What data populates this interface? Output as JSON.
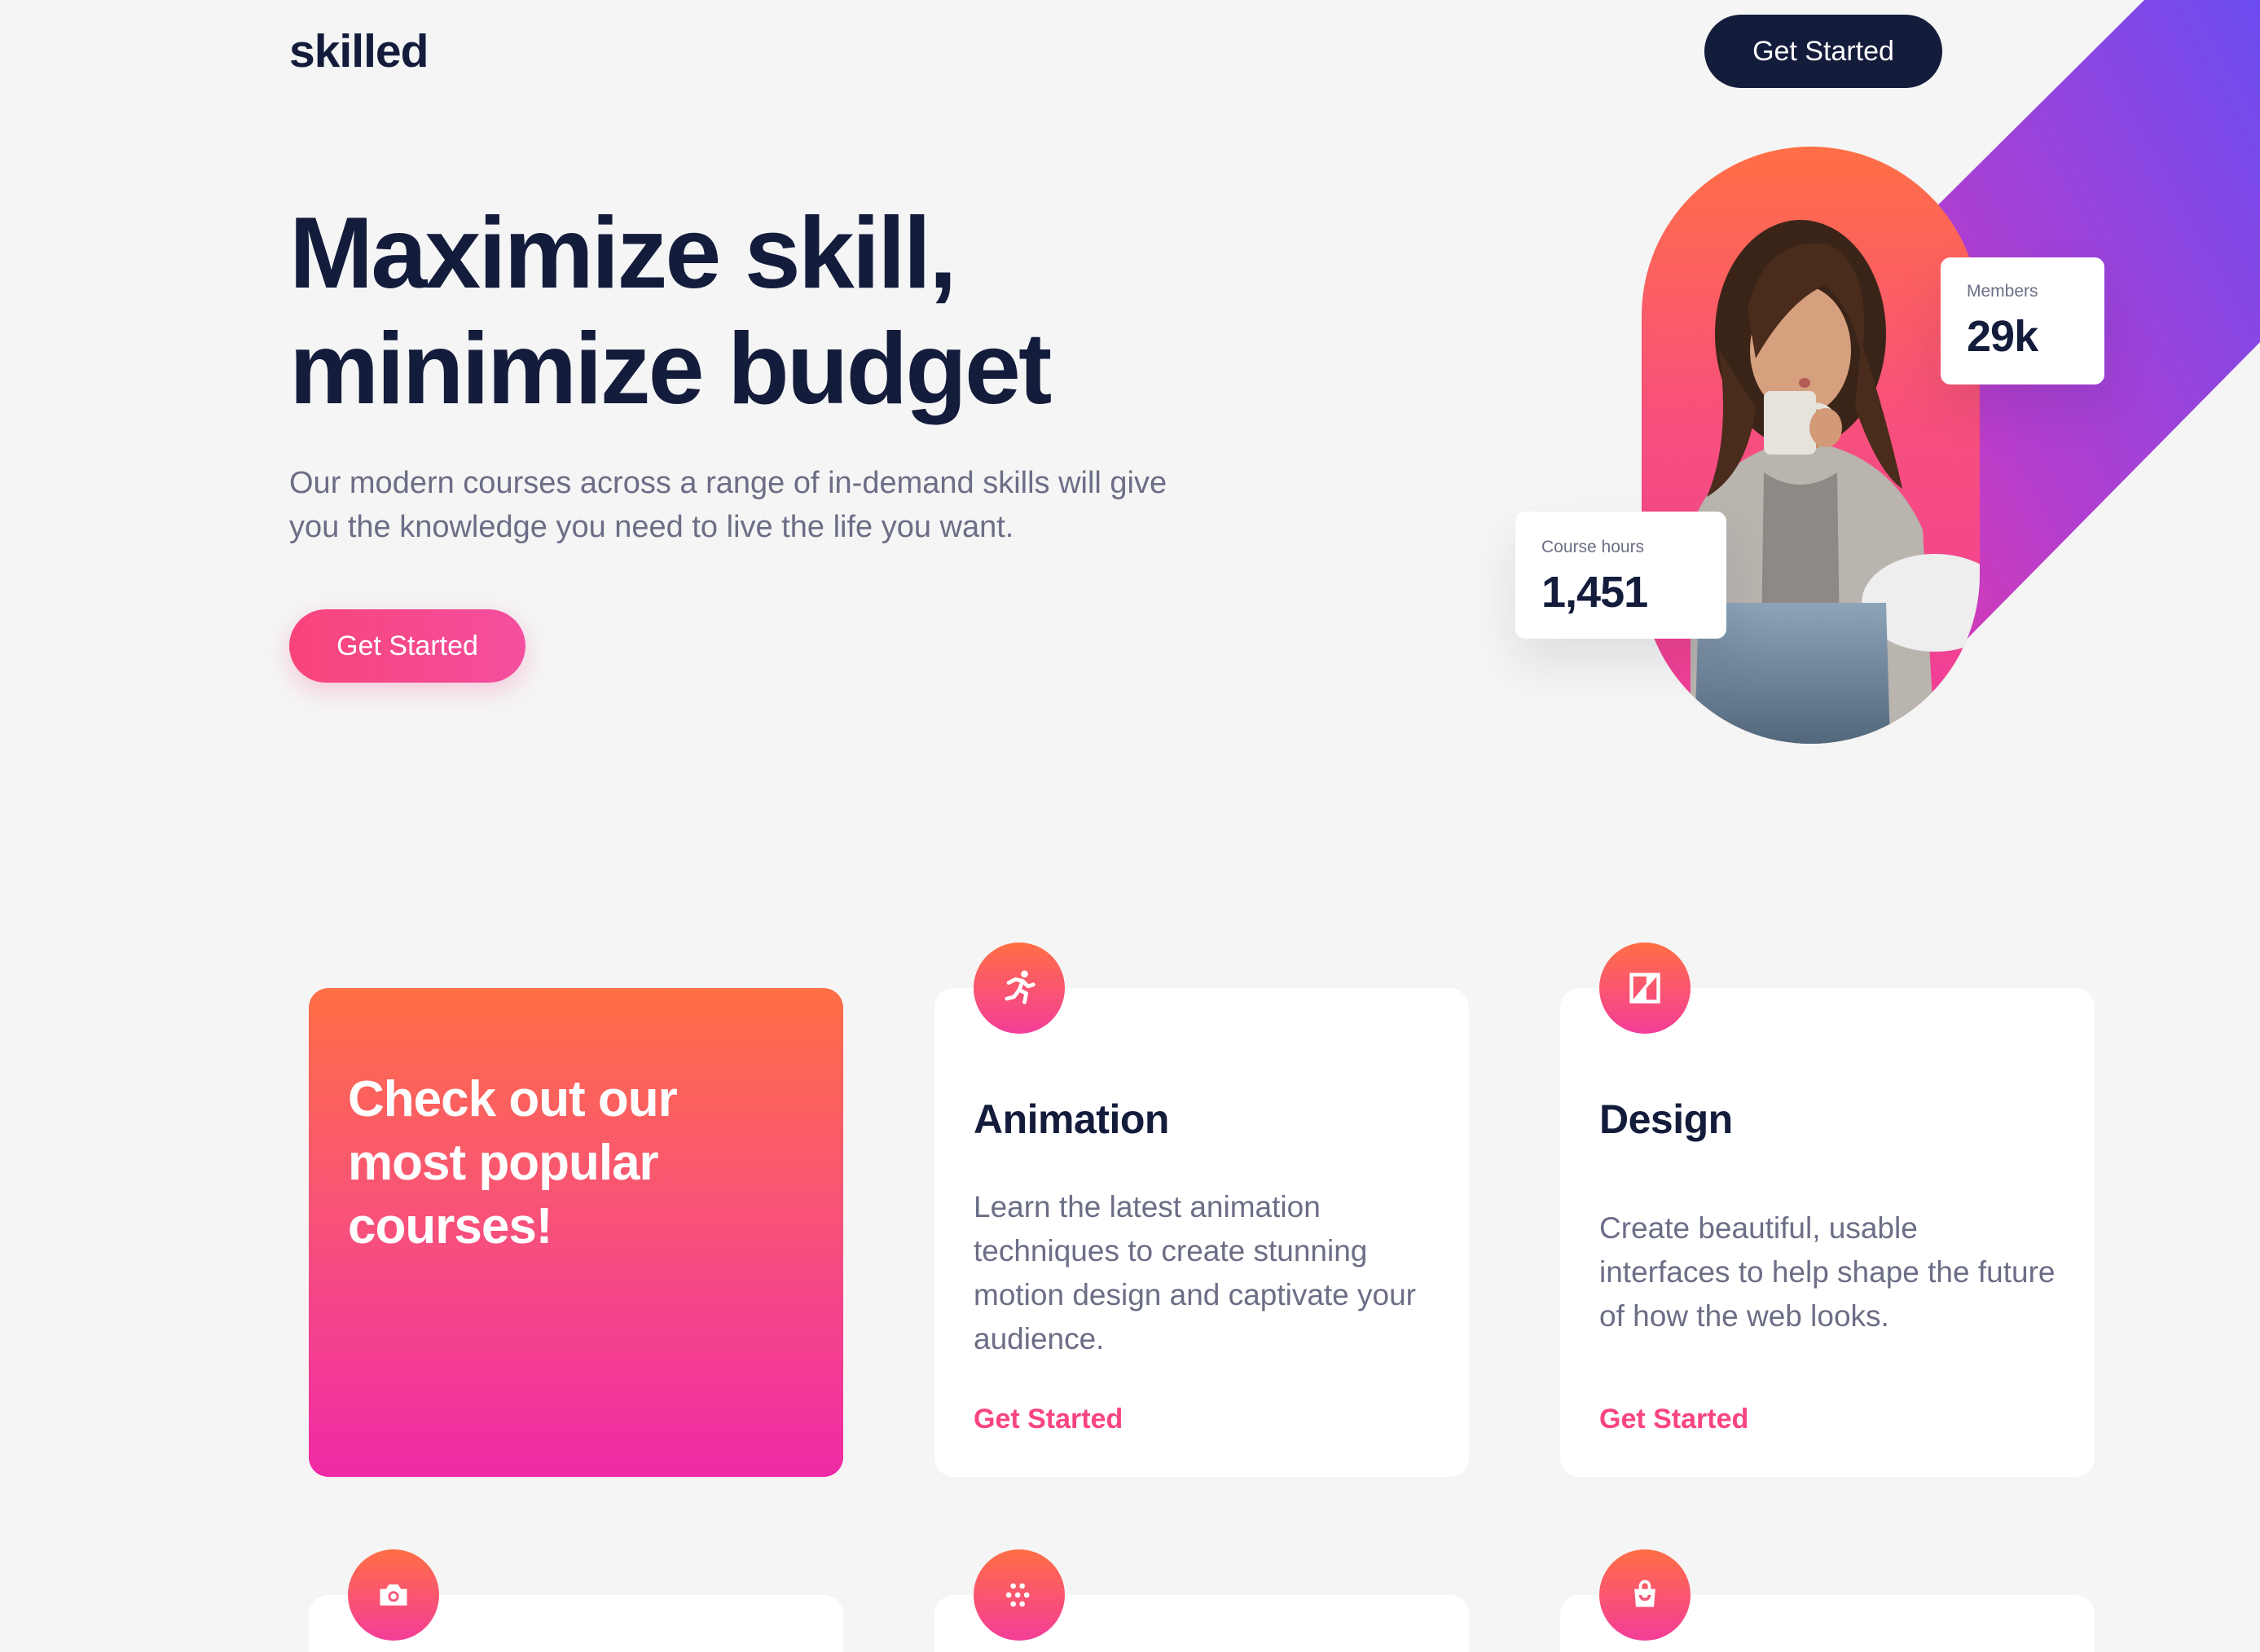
{
  "brand": {
    "logo": "skilled"
  },
  "nav": {
    "cta_label": "Get Started"
  },
  "hero": {
    "title_line1": "Maximize skill,",
    "title_line2": "minimize budget",
    "subtitle": "Our modern courses across a range of in-demand skills will give you the knowledge you need to live the life you want.",
    "cta_label": "Get Started"
  },
  "stats": [
    {
      "label": "Members",
      "value": "29k"
    },
    {
      "label": "Course hours",
      "value": "1,451"
    }
  ],
  "promo": {
    "title": "Check out our most popular courses!"
  },
  "courses": [
    {
      "icon": "running-person-icon",
      "title": "Animation",
      "description": "Learn the latest animation techniques to create stunning motion design and captivate your audience.",
      "link_label": "Get Started"
    },
    {
      "icon": "design-frame-icon",
      "title": "Design",
      "description": "Create beautiful, usable interfaces to help shape the future of how the web looks.",
      "link_label": "Get Started"
    }
  ],
  "more_course_icons": [
    "camera-icon",
    "dots-grid-icon",
    "shopping-bag-icon"
  ],
  "colors": {
    "navy": "#141c3c",
    "accent_pink": "#f7457e",
    "gradient_top": "#ff6f45",
    "gradient_bottom": "#ef2aa6",
    "stripe_purple": "#6b4cf0",
    "background": "#f5f5f5"
  }
}
